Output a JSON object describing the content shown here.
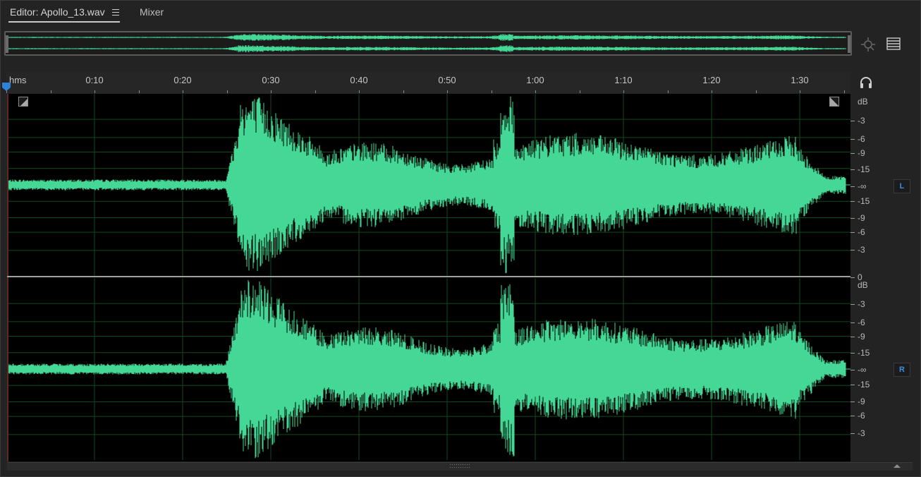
{
  "tabs": {
    "editor_label": "Editor: Apollo_13.wav",
    "mixer_label": "Mixer"
  },
  "ruler": {
    "unit_label": "hms",
    "time_labels": [
      "0:10",
      "0:20",
      "0:30",
      "0:40",
      "0:50",
      "1:00",
      "1:10",
      "1:20",
      "1:30"
    ]
  },
  "channels": {
    "left_label": "L",
    "right_label": "R"
  },
  "db_scale": {
    "unit": "dB",
    "labels": [
      "-3",
      "-6",
      "-9",
      "-15",
      "-∞",
      "-15",
      "-9",
      "-6",
      "-3",
      "0"
    ]
  },
  "colors": {
    "waveform": "#45d795",
    "grid": "#0f4a1e",
    "background": "#000000",
    "accent": "#2f80d8"
  },
  "icons": {
    "menu": "hamburger-icon",
    "zoom": "zoom-selection-icon",
    "list": "list-view-icon",
    "headphones": "headphones-icon",
    "playhead": "playhead-icon"
  }
}
